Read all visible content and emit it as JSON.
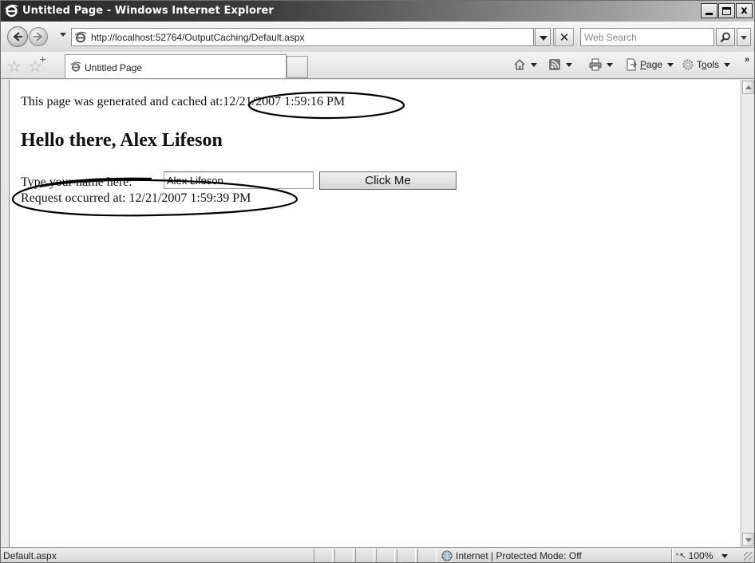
{
  "window": {
    "title": "Untitled Page - Windows Internet Explorer",
    "controls": {
      "minimize": "_",
      "maximize": "□",
      "close": "x"
    }
  },
  "address_bar": {
    "url": "http://localhost:52764/OutputCaching/Default.aspx",
    "search_placeholder": "Web Search"
  },
  "tabs": [
    {
      "label": "Untitled Page"
    }
  ],
  "command_bar": {
    "page_label": "Page",
    "page_accel": "P",
    "page_rest": "age",
    "tools_label": "Tools",
    "tools_pre": "T",
    "tools_accel": "o",
    "tools_rest": "ols",
    "more": "»"
  },
  "content": {
    "cached_prefix": "This page was generated and cached at:",
    "cached_time": "12/21/2007 1:59:16 PM",
    "greeting": "Hello there, Alex Lifeson",
    "name_label": "Type your name here:",
    "name_value": "Alex Lifeson",
    "button_label": "Click Me",
    "request_prefix": "Request occurred at:",
    "request_time": "12/21/2007 1:59:39 PM"
  },
  "status_bar": {
    "status_text": "Default.aspx",
    "zone": "Internet | Protected Mode: Off",
    "zoom": "100%"
  },
  "colors": {
    "annotation_ellipse": "#000000",
    "content_bg": "#ffffff",
    "chrome_bg": "#e6e6e6"
  }
}
